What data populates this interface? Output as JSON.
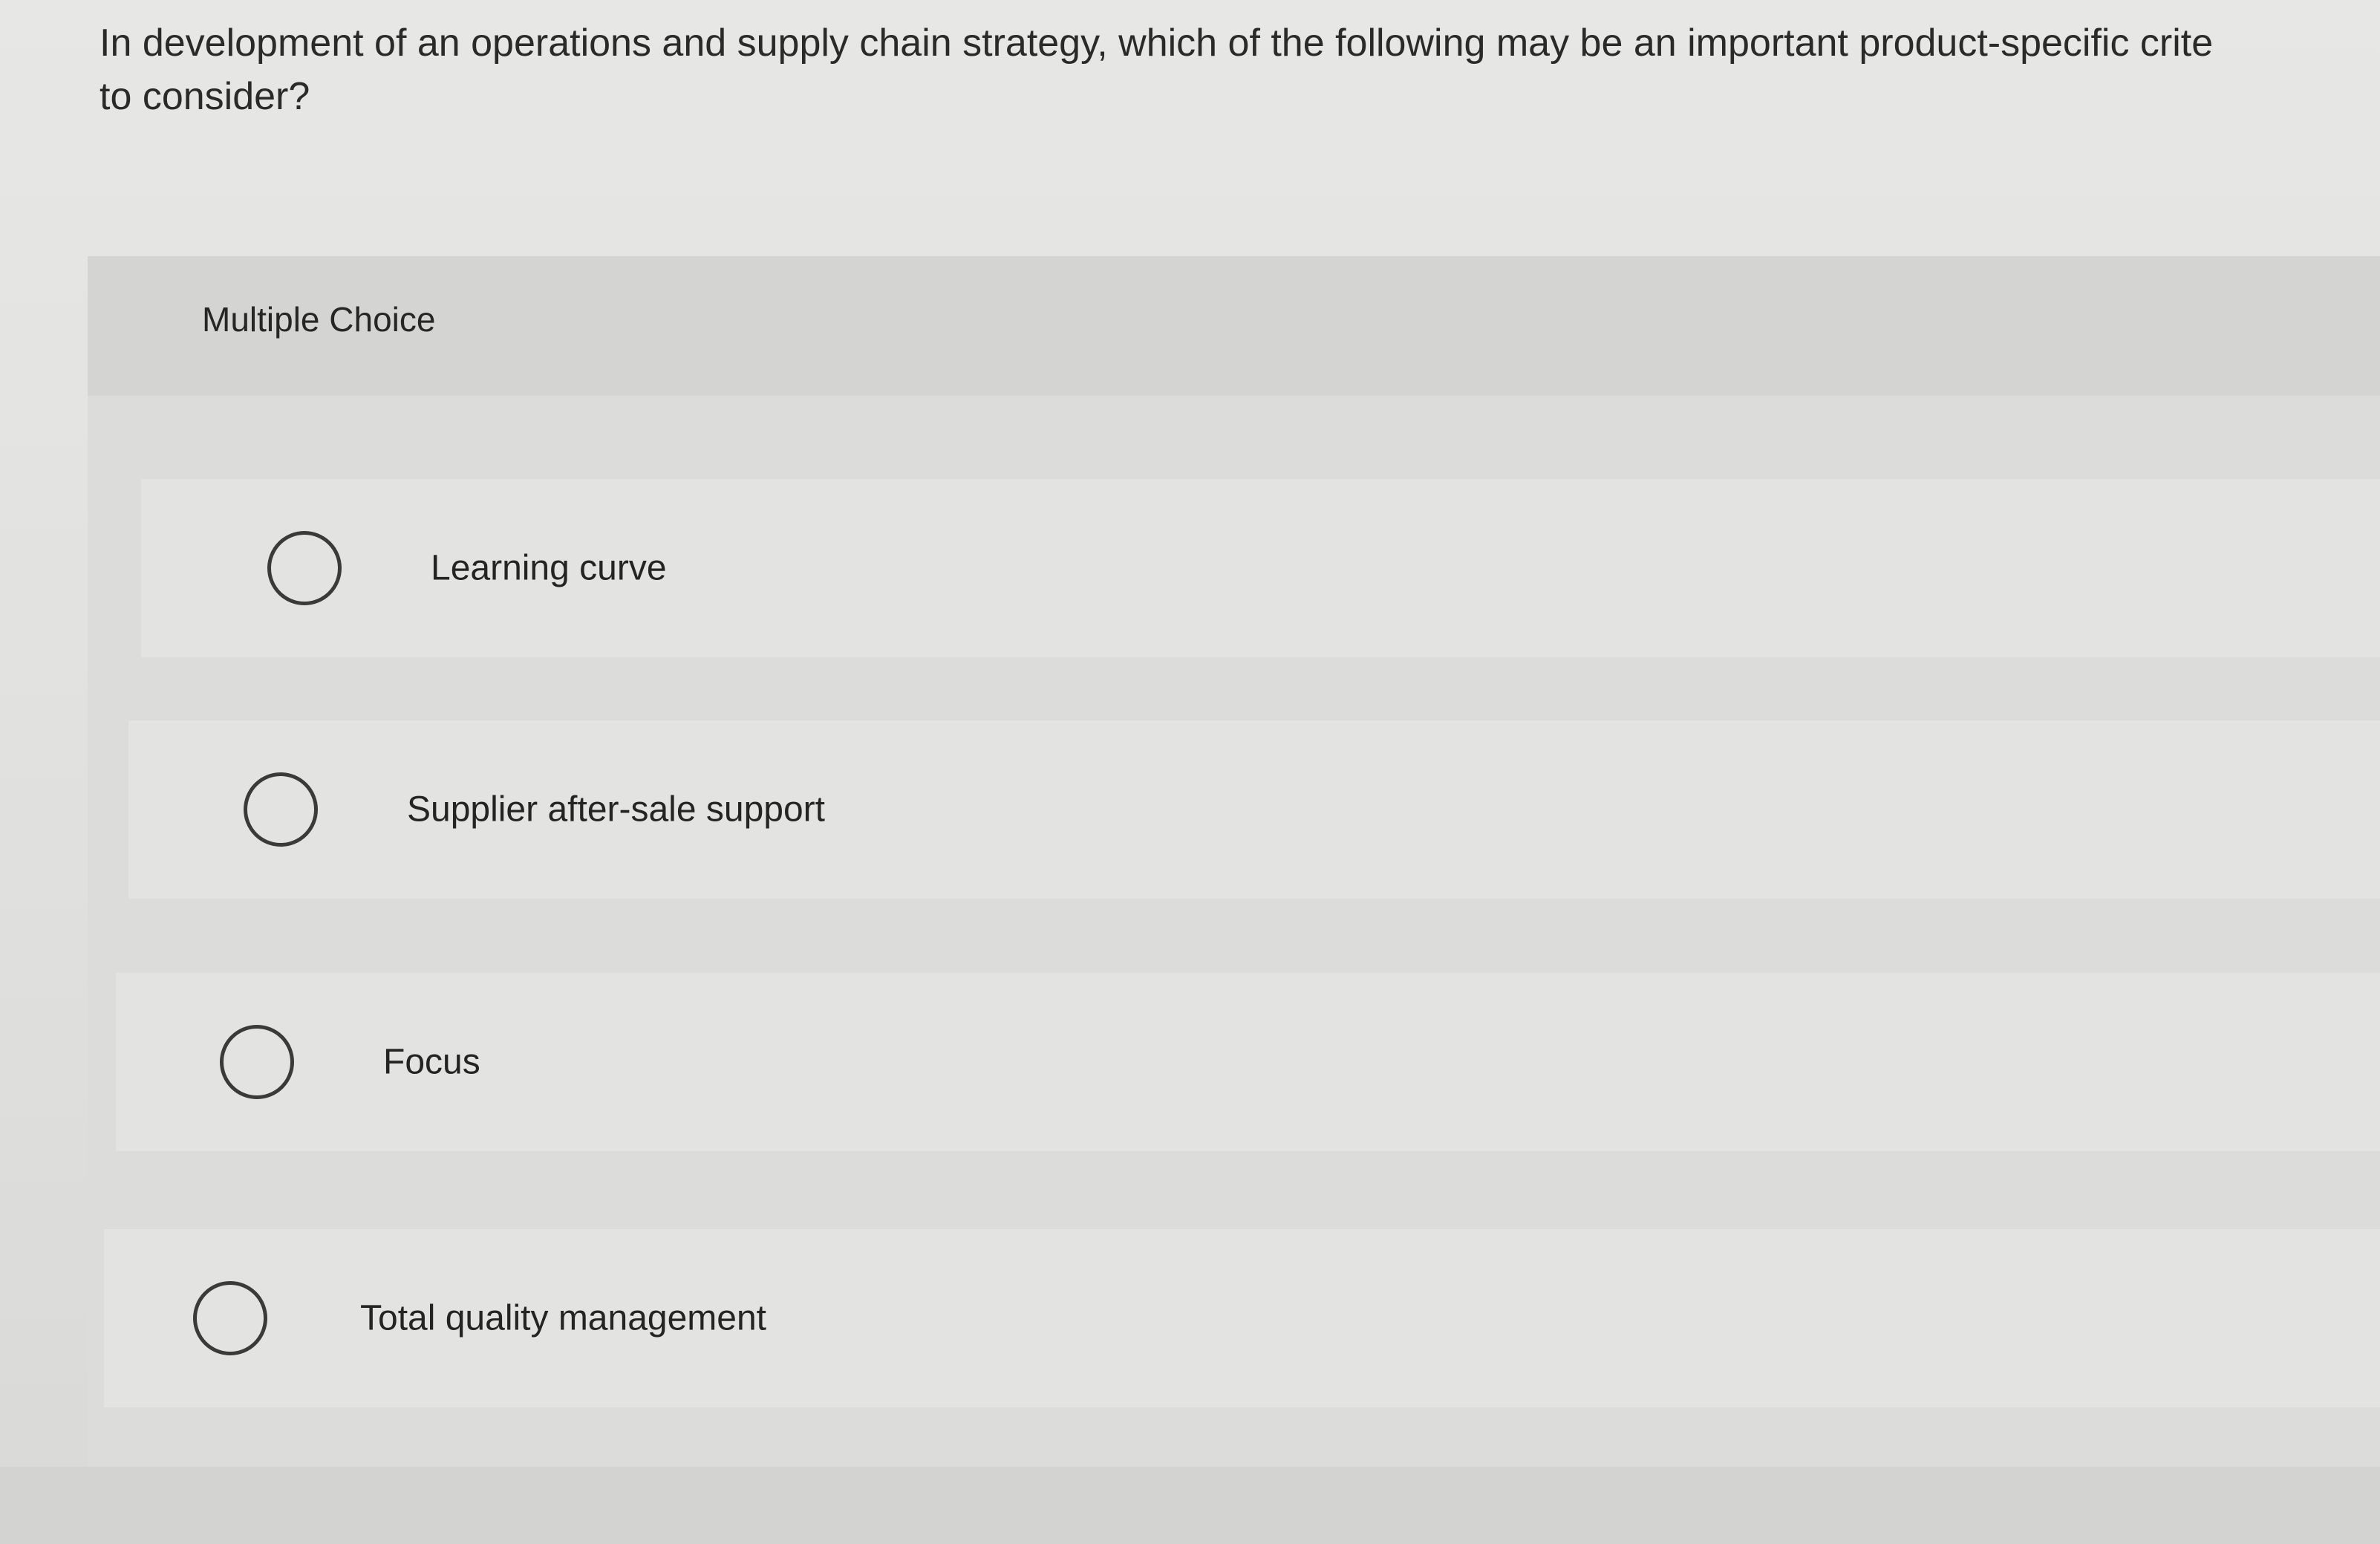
{
  "question": {
    "line1": "In development of an operations and supply chain strategy, which of the following may be an important product-specific crite",
    "line2": "to consider?"
  },
  "multiple_choice": {
    "label": "Multiple Choice",
    "options": [
      {
        "label": "Learning curve"
      },
      {
        "label": "Supplier after-sale support"
      },
      {
        "label": "Focus"
      },
      {
        "label": "Total quality management"
      }
    ]
  }
}
